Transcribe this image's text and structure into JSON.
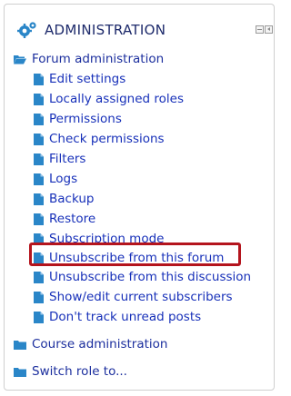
{
  "block": {
    "title": "ADMINISTRATION",
    "icons": {
      "header": "gear-icon",
      "dock": "dock-icon",
      "collapse": "collapse-icon"
    }
  },
  "forum_admin": {
    "label": "Forum administration",
    "items": [
      {
        "label": "Edit settings"
      },
      {
        "label": "Locally assigned roles"
      },
      {
        "label": "Permissions"
      },
      {
        "label": "Check permissions"
      },
      {
        "label": "Filters"
      },
      {
        "label": "Logs"
      },
      {
        "label": "Backup"
      },
      {
        "label": "Restore"
      },
      {
        "label": "Subscription mode"
      },
      {
        "label": "Unsubscribe from this forum"
      },
      {
        "label": "Unsubscribe from this discussion"
      },
      {
        "label": "Show/edit current subscribers"
      },
      {
        "label": "Don't track unread posts"
      }
    ]
  },
  "course_admin": {
    "label": "Course administration"
  },
  "switch_role": {
    "label": "Switch role to..."
  },
  "colors": {
    "link": "#1730b9",
    "title": "#1d2a6b",
    "icon": "#2a86c8",
    "highlight": "#b4141d"
  }
}
